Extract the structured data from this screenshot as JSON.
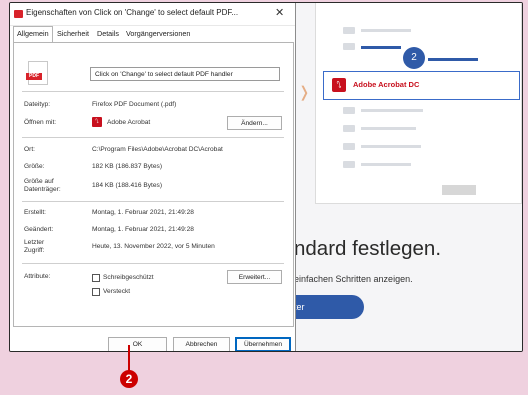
{
  "dialog": {
    "title": "Eigenschaften von Click on 'Change' to select default PDF...",
    "close": "✕",
    "tabs": [
      "Allgemein",
      "Sicherheit",
      "Details",
      "Vorgängerversionen"
    ],
    "file_name": "Click on 'Change' to select default PDF handler",
    "pdf_icon_text": "PDF",
    "rows": {
      "type_label": "Dateityp:",
      "type_value": "Firefox PDF Document (.pdf)",
      "opens_label": "Öffnen mit:",
      "opens_value": "Adobe Acrobat",
      "change_button": "Ändern...",
      "location_label": "Ort:",
      "location_value": "C:\\Program Files\\Adobe\\Acrobat DC\\Acrobat",
      "size_label": "Größe:",
      "size_value": "182 KB (186.837 Bytes)",
      "disk_label": "Größe auf Datenträger:",
      "disk_value": "184 KB (188.416 Bytes)",
      "created_label": "Erstellt:",
      "created_value": "Montag, 1. Februar 2021, 21:49:28",
      "modified_label": "Geändert:",
      "modified_value": "Montag, 1. Februar 2021, 21:49:28",
      "accessed_label": "Letzter Zugriff:",
      "accessed_value": "Heute, 13. November 2022, vor 5 Minuten",
      "attributes_label": "Attribute:",
      "readonly_label": "Schreibgeschützt",
      "hidden_label": "Versteckt",
      "advanced_button": "Erweitert..."
    },
    "buttons": {
      "ok": "OK",
      "cancel": "Abbrechen",
      "apply": "Übernehmen"
    }
  },
  "background": {
    "step_badge": "2",
    "selected_app": "Adobe Acrobat DC",
    "heading": "ndard festlegen.",
    "subtext": "einfachen Schritten anzeigen.",
    "button_label": "ter"
  },
  "callout": {
    "number": "2",
    "color": "#cc0000"
  }
}
